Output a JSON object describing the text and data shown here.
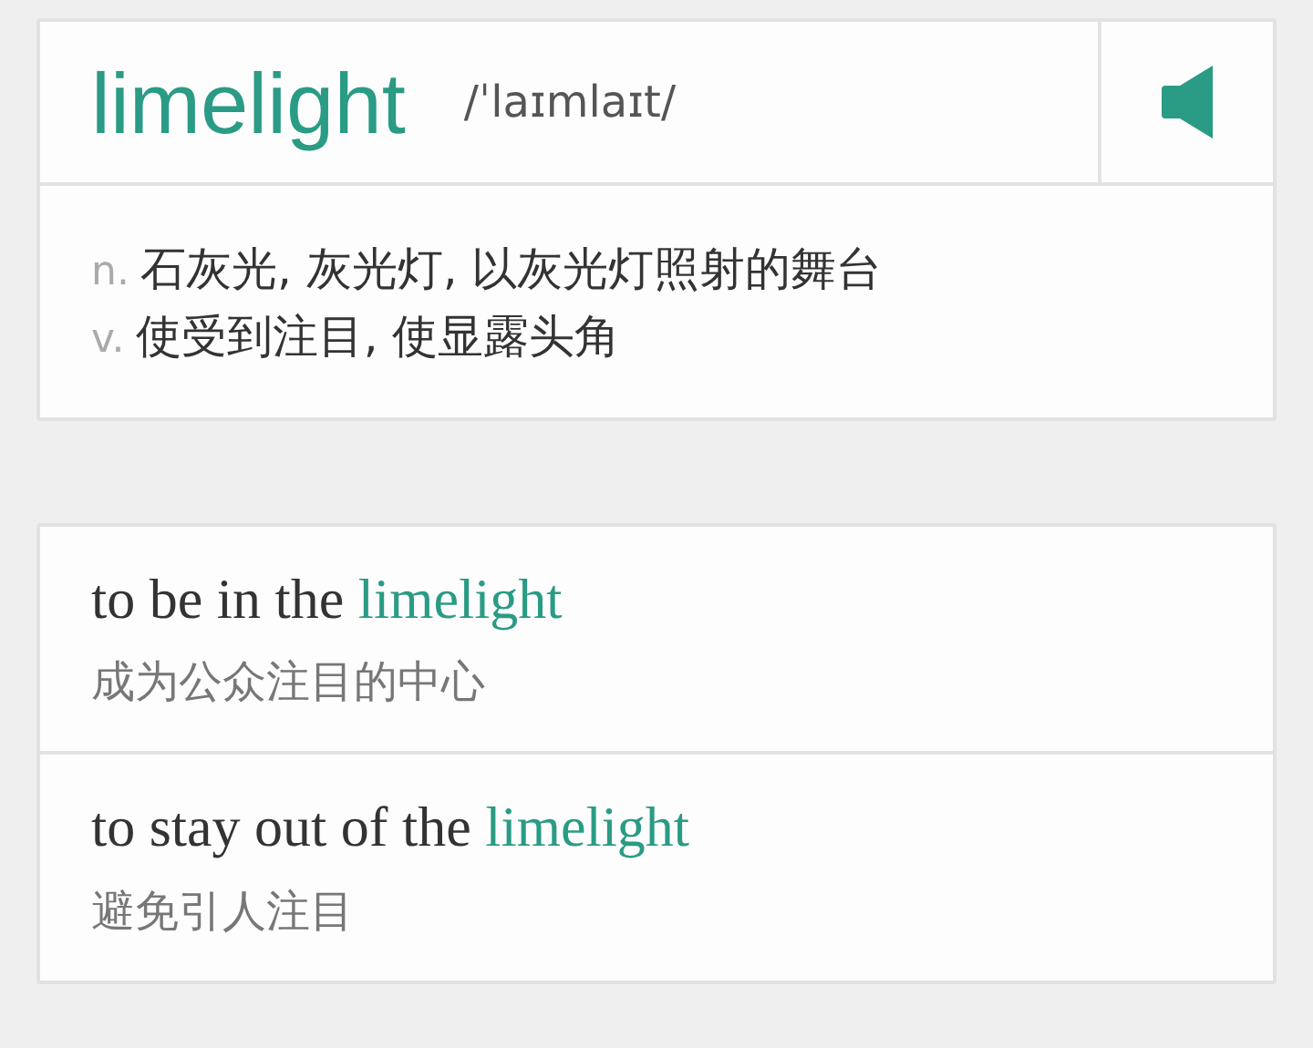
{
  "entry": {
    "word": "limelight",
    "phonetic": "/ˈlaɪmlaɪt/"
  },
  "definitions": [
    {
      "pos": "n.",
      "meaning": "石灰光, 灰光灯, 以灰光灯照射的舞台"
    },
    {
      "pos": "v.",
      "meaning": "使受到注目, 使显露头角"
    }
  ],
  "phrases": [
    {
      "text": "to be in the ",
      "highlight": "limelight",
      "translation": "成为公众注目的中心"
    },
    {
      "text": "to stay out of the ",
      "highlight": "limelight",
      "translation": "避免引人注目"
    }
  ]
}
